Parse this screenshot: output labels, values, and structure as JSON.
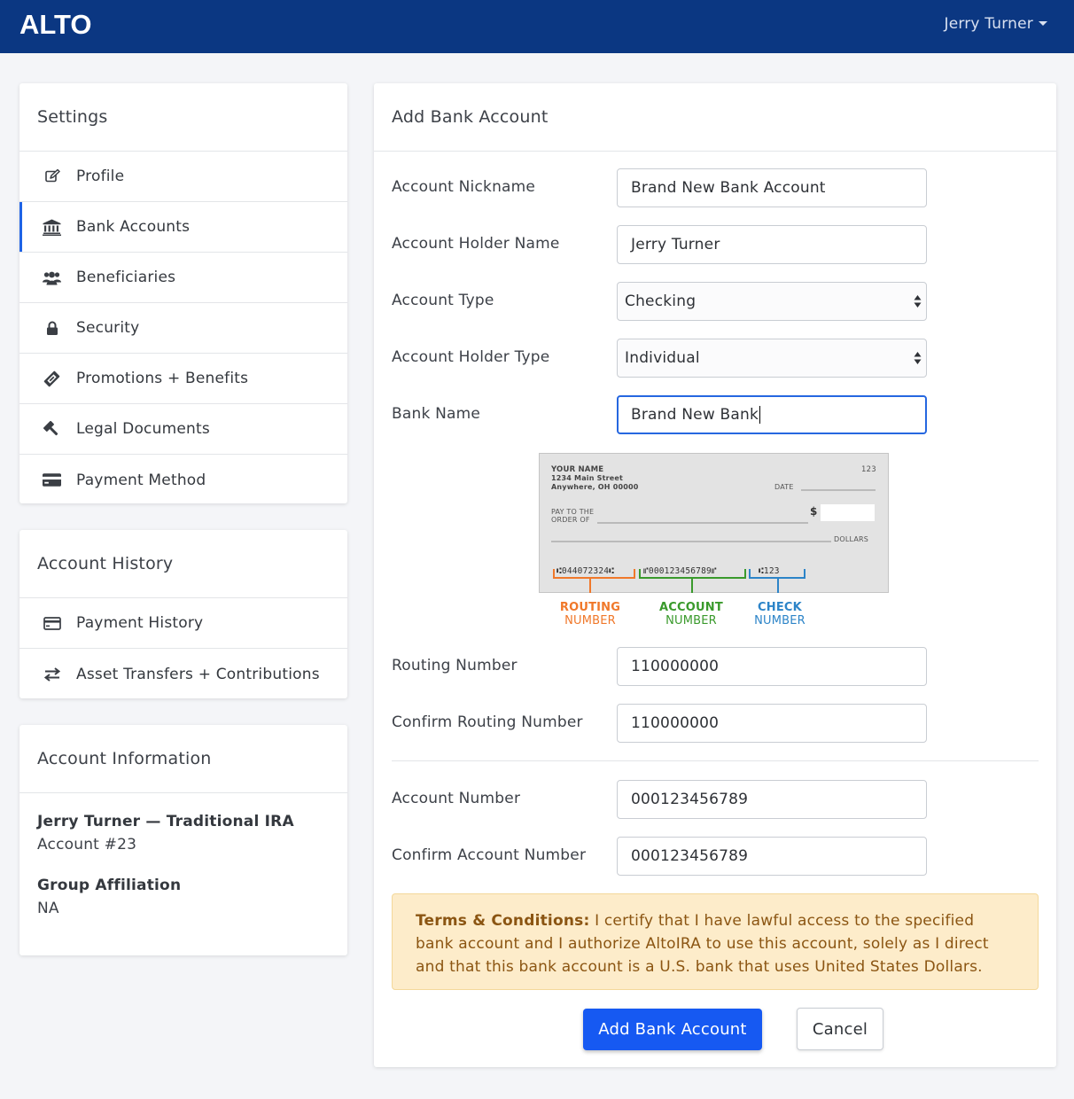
{
  "header": {
    "logo": "ALTO",
    "user_name": "Jerry Turner"
  },
  "settings": {
    "title": "Settings",
    "items": [
      {
        "label": "Profile",
        "icon": "edit-icon"
      },
      {
        "label": "Bank Accounts",
        "icon": "bank-icon",
        "active": true
      },
      {
        "label": "Beneficiaries",
        "icon": "users-icon"
      },
      {
        "label": "Security",
        "icon": "lock-icon"
      },
      {
        "label": "Promotions + Benefits",
        "icon": "ticket-icon"
      },
      {
        "label": "Legal Documents",
        "icon": "gavel-icon"
      },
      {
        "label": "Payment Method",
        "icon": "credit-card-icon"
      }
    ]
  },
  "history": {
    "title": "Account History",
    "items": [
      {
        "label": "Payment History",
        "icon": "credit-card-icon"
      },
      {
        "label": "Asset Transfers + Contributions",
        "icon": "exchange-icon"
      }
    ]
  },
  "account_info": {
    "title": "Account Information",
    "account_name": "Jerry Turner — Traditional IRA",
    "account_number": "Account #23",
    "group_label": "Group Affiliation",
    "group_value": "NA"
  },
  "form": {
    "title": "Add Bank Account",
    "nickname_label": "Account Nickname",
    "nickname_value": "Brand New Bank Account",
    "holder_name_label": "Account Holder Name",
    "holder_name_value": "Jerry Turner",
    "account_type_label": "Account Type",
    "account_type_value": "Checking",
    "holder_type_label": "Account Holder Type",
    "holder_type_value": "Individual",
    "bank_name_label": "Bank Name",
    "bank_name_value": "Brand New Bank",
    "routing_label": "Routing Number",
    "routing_value": "110000000",
    "confirm_routing_label": "Confirm Routing Number",
    "confirm_routing_value": "110000000",
    "account_number_label": "Account Number",
    "account_number_value": "000123456789",
    "confirm_account_label": "Confirm Account Number",
    "confirm_account_value": "000123456789",
    "terms_bold": "Terms & Conditions:",
    "terms_text": "I certify that I have lawful access to the specified bank account and I authorize AltoIRA to use this account, solely as I direct and that this bank account is a U.S. bank that uses United States Dollars.",
    "submit_label": "Add Bank Account",
    "cancel_label": "Cancel"
  },
  "check_image": {
    "name": "YOUR NAME",
    "street": "1234 Main Street",
    "city": "Anywhere, OH 00000",
    "check_no": "123",
    "date_label": "DATE",
    "pay_label_1": "PAY TO THE",
    "pay_label_2": "ORDER OF",
    "dollar_sign": "$",
    "dollars_label": "DOLLARS",
    "micr_routing": "⑆044072324⑆",
    "micr_account": "⑈000123456789⑈",
    "micr_check": "⑆123",
    "routing_caption_1": "ROUTING",
    "routing_caption_2": "NUMBER",
    "account_caption_1": "ACCOUNT",
    "account_caption_2": "NUMBER",
    "check_caption_1": "CHECK",
    "check_caption_2": "NUMBER"
  },
  "colors": {
    "navbar": "#0b3782",
    "accent": "#1e63e6",
    "primary_button": "#1659f2",
    "terms_bg": "#fdecca",
    "terms_text": "#8b5512",
    "routing": "#f0782a",
    "account": "#3a9a2c",
    "check": "#2c84c8"
  }
}
